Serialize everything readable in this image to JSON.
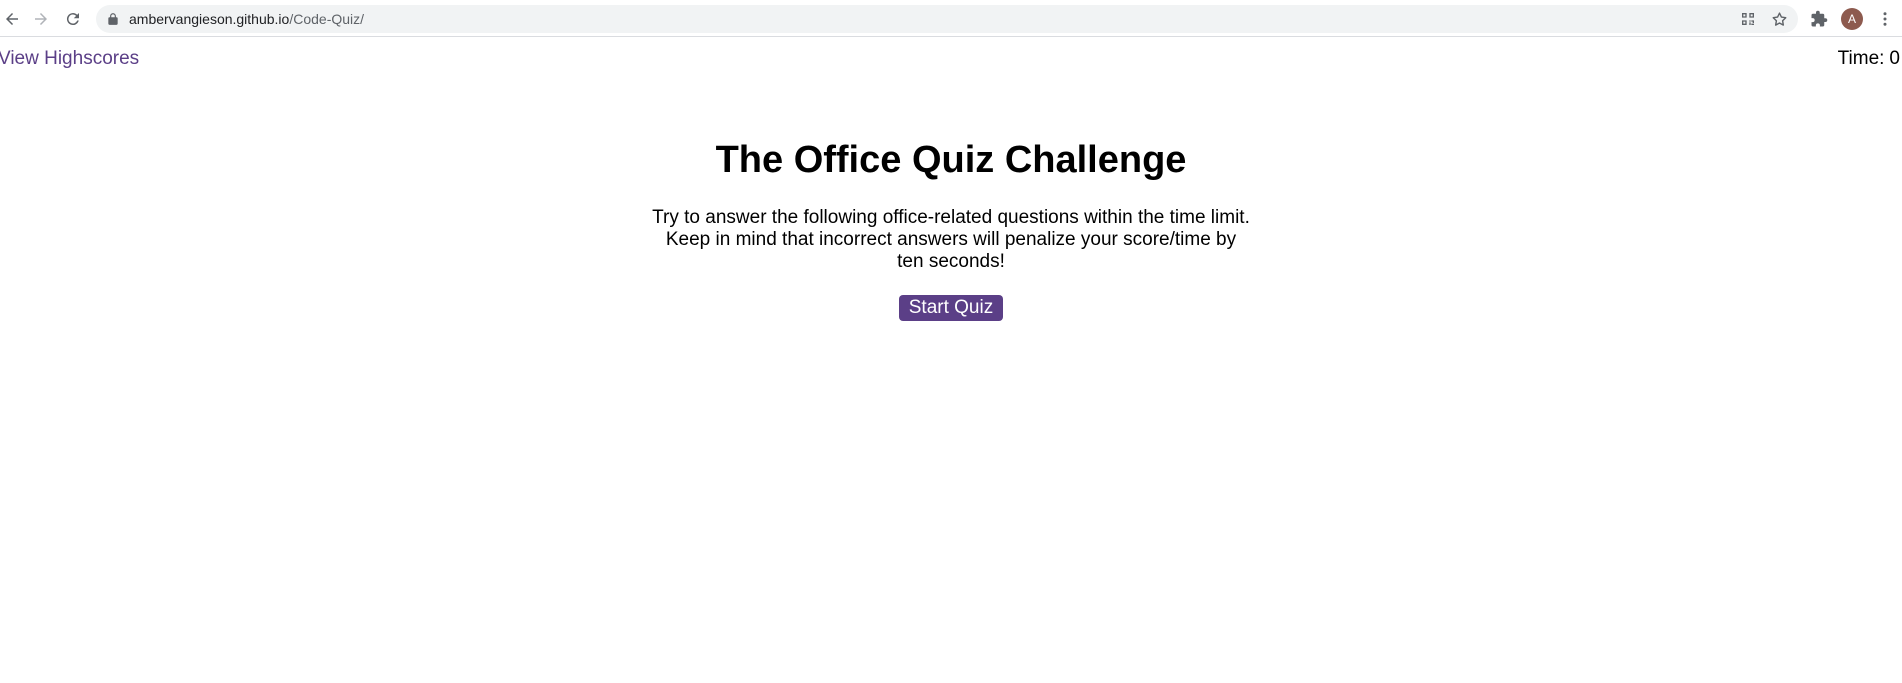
{
  "browser": {
    "url_host": "ambervangieson.github.io",
    "url_path": "/Code-Quiz/",
    "profile_initial": "A"
  },
  "nav": {
    "highscores_label": "View Highscores",
    "timer_label": "Time:",
    "timer_value": "0"
  },
  "intro": {
    "title": "The Office Quiz Challenge",
    "description": "Try to answer the following office-related questions within the time limit. Keep in mind that incorrect answers will penalize your score/time by ten seconds!",
    "start_label": "Start Quiz"
  },
  "icons": {
    "back": "arrow-left",
    "forward": "arrow-right",
    "reload": "reload",
    "lock": "lock",
    "qr": "qr-code",
    "bookmark": "star",
    "extensions": "puzzle-piece",
    "menu": "three-dots-vertical"
  },
  "colors": {
    "accent": "#5b3f87",
    "toolbar_bg": "#f1f3f4",
    "avatar": "#8d5a4e"
  }
}
